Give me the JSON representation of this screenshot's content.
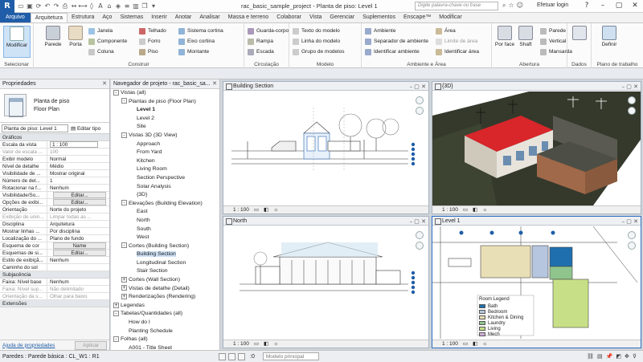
{
  "titlebar": {
    "logo": "R",
    "title": "rac_basic_sample_project - Planta de piso: Level 1",
    "search_placeholder": "Digite palavra-chave ou frase",
    "signin": "Efetuar login"
  },
  "ribbon_tabs": [
    "Arquivo",
    "Arquitetura",
    "Estrutura",
    "Aço",
    "Sistemas",
    "Inserir",
    "Anotar",
    "Analisar",
    "Massa e terreno",
    "Colaborar",
    "Vista",
    "Gerenciar",
    "Suplementos",
    "Enscape™",
    "Modificar"
  ],
  "ribbon": {
    "groups": {
      "selecionar": "Selecionar",
      "construir": "Construir",
      "circulacao": "Circulação",
      "modelo": "Modelo",
      "ambiente_area": "Ambiente e Área",
      "abertura": "Abertura",
      "dados": "Dados",
      "plano": "Plano de trabalho"
    },
    "modify": "Modificar",
    "parede": "Parede",
    "porta": "Porta",
    "janela": "Janela",
    "componente": "Componente",
    "coluna": "Coluna",
    "telhado": "Telhado",
    "forro": "Forro",
    "piso": "Piso",
    "sistema_cortina": "Sistema cortina",
    "eixo_cortina": "Eixo cortina",
    "montante": "Montante",
    "guarda_corpo": "Guarda-corpo",
    "rampa": "Rampa",
    "escada": "Escada",
    "texto_modelo": "Texto do modelo",
    "linha_modelo": "Linha do modelo",
    "grupo_modelos": "Grupo de modelos",
    "ambiente": "Ambiente",
    "separador_ambiente": "Separador de ambiente",
    "identificar_ambiente": "Identificar ambiente",
    "area": "Área",
    "limite_area": "Limite de área",
    "identificar_area": "Identificar área",
    "por_face": "Por face",
    "shaft": "Shaft",
    "parede_ab": "Parede",
    "vertical": "Vertical",
    "mansarda": "Mansarda",
    "definir": "Definir"
  },
  "properties": {
    "title": "Propriedades",
    "type_name_1": "Planta de piso",
    "type_name_2": "Floor Plan",
    "instance": "Planta de piso: Level 1",
    "edit_type": "Editar tipo",
    "cat_graphics": "Gráficos",
    "cat_underlay": "Subjacência",
    "cat_extents": "Extensões",
    "rows_graphics": [
      {
        "k": "Escala da vista",
        "v": "1 : 100",
        "kind": "input"
      },
      {
        "k": "Valor de escala ...",
        "v": "100",
        "kind": "dim"
      },
      {
        "k": "Exibir modelo",
        "v": "Normal"
      },
      {
        "k": "Nível de detalhe",
        "v": "Médio"
      },
      {
        "k": "Visibilidade de ...",
        "v": "Mostrar original"
      },
      {
        "k": "Número de det...",
        "v": "1"
      },
      {
        "k": "Rotacionar na f...",
        "v": "Nenhum"
      },
      {
        "k": "Visibilidade/So...",
        "v": "Editar...",
        "kind": "btn"
      },
      {
        "k": "Opções de exibi...",
        "v": "Editar...",
        "kind": "btn"
      },
      {
        "k": "Orientação",
        "v": "Norte do projeto"
      },
      {
        "k": "Exibição de unin...",
        "v": "Limpar todas as ...",
        "kind": "dim"
      },
      {
        "k": "Disciplina",
        "v": "Arquitetura"
      },
      {
        "k": "Mostrar linhas ...",
        "v": "Por disciplina"
      },
      {
        "k": "Localização do ...",
        "v": "Plano de fundo"
      },
      {
        "k": "Esquema de cor",
        "v": "Name",
        "kind": "btn"
      },
      {
        "k": "Esquemas de si...",
        "v": "Editar...",
        "kind": "btn"
      },
      {
        "k": "Estilo de exibiçã...",
        "v": "Nenhum"
      },
      {
        "k": "Caminho do sol",
        "v": ""
      }
    ],
    "rows_underlay": [
      {
        "k": "Faixa: Nível base",
        "v": "Nenhum"
      },
      {
        "k": "Faixa: Nível sup...",
        "v": "Não delimitado",
        "kind": "dim"
      },
      {
        "k": "Orientação da s...",
        "v": "Olhar para baixo",
        "kind": "dim"
      }
    ],
    "help": "Ajuda de propriedades",
    "apply": "Aplicar"
  },
  "browser": {
    "title": "Navegador de projeto - rac_basic_sa...",
    "nodes": [
      {
        "t": "Vistas (all)",
        "lvl": 0,
        "exp": "-"
      },
      {
        "t": "Plantas de piso (Floor Plan)",
        "lvl": 1,
        "exp": "-"
      },
      {
        "t": "Level 1",
        "lvl": 2,
        "bold": true
      },
      {
        "t": "Level 2",
        "lvl": 2
      },
      {
        "t": "Site",
        "lvl": 2
      },
      {
        "t": "Vistas 3D (3D View)",
        "lvl": 1,
        "exp": "-"
      },
      {
        "t": "Approach",
        "lvl": 2
      },
      {
        "t": "From Yard",
        "lvl": 2
      },
      {
        "t": "Kitchen",
        "lvl": 2
      },
      {
        "t": "Living Room",
        "lvl": 2
      },
      {
        "t": "Section Perspective",
        "lvl": 2
      },
      {
        "t": "Solar Analysis",
        "lvl": 2
      },
      {
        "t": "{3D}",
        "lvl": 2
      },
      {
        "t": "Elevações (Building Elevation)",
        "lvl": 1,
        "exp": "-"
      },
      {
        "t": "East",
        "lvl": 2
      },
      {
        "t": "North",
        "lvl": 2
      },
      {
        "t": "South",
        "lvl": 2
      },
      {
        "t": "West",
        "lvl": 2
      },
      {
        "t": "Cortes (Building Section)",
        "lvl": 1,
        "exp": "-"
      },
      {
        "t": "Building Section",
        "lvl": 2,
        "sel": true
      },
      {
        "t": "Longitudinal Section",
        "lvl": 2
      },
      {
        "t": "Stair Section",
        "lvl": 2
      },
      {
        "t": "Cortes (Wall Section)",
        "lvl": 1,
        "exp": "+"
      },
      {
        "t": "Vistas de detalhe (Detail)",
        "lvl": 1,
        "exp": "+"
      },
      {
        "t": "Renderizações (Rendering)",
        "lvl": 1,
        "exp": "+"
      },
      {
        "t": "Legendas",
        "lvl": 0,
        "exp": "+"
      },
      {
        "t": "Tabelas/Quantidades (all)",
        "lvl": 0,
        "exp": "-"
      },
      {
        "t": "How do I",
        "lvl": 1
      },
      {
        "t": "Planting Schedule",
        "lvl": 1
      },
      {
        "t": "Folhas (all)",
        "lvl": 0,
        "exp": "-"
      },
      {
        "t": "A001 - Title Sheet",
        "lvl": 1
      }
    ]
  },
  "views": {
    "section": {
      "title": "Building Section",
      "scale": "1 : 100"
    },
    "threed": {
      "title": "{3D}",
      "scale": "1 : 100"
    },
    "north": {
      "title": "North",
      "scale": "1 : 100"
    },
    "level1": {
      "title": "Level 1",
      "scale": "1 : 100",
      "legend_title": "Room Legend",
      "legend": [
        "Bath",
        "Bedroom",
        "Kitchen & Dining",
        "Laundry",
        "Living",
        "Mech"
      ]
    }
  },
  "statusbar": {
    "text": "Paredes : Parede básica : CL_W1 : R1",
    "model": "Modelo principal",
    "zero": ":0"
  },
  "colors": {
    "roof_red": "#d8262a",
    "file_tab": "#1f5da8",
    "terrain_dark": "#34392b",
    "selection": "#cde0f5"
  }
}
